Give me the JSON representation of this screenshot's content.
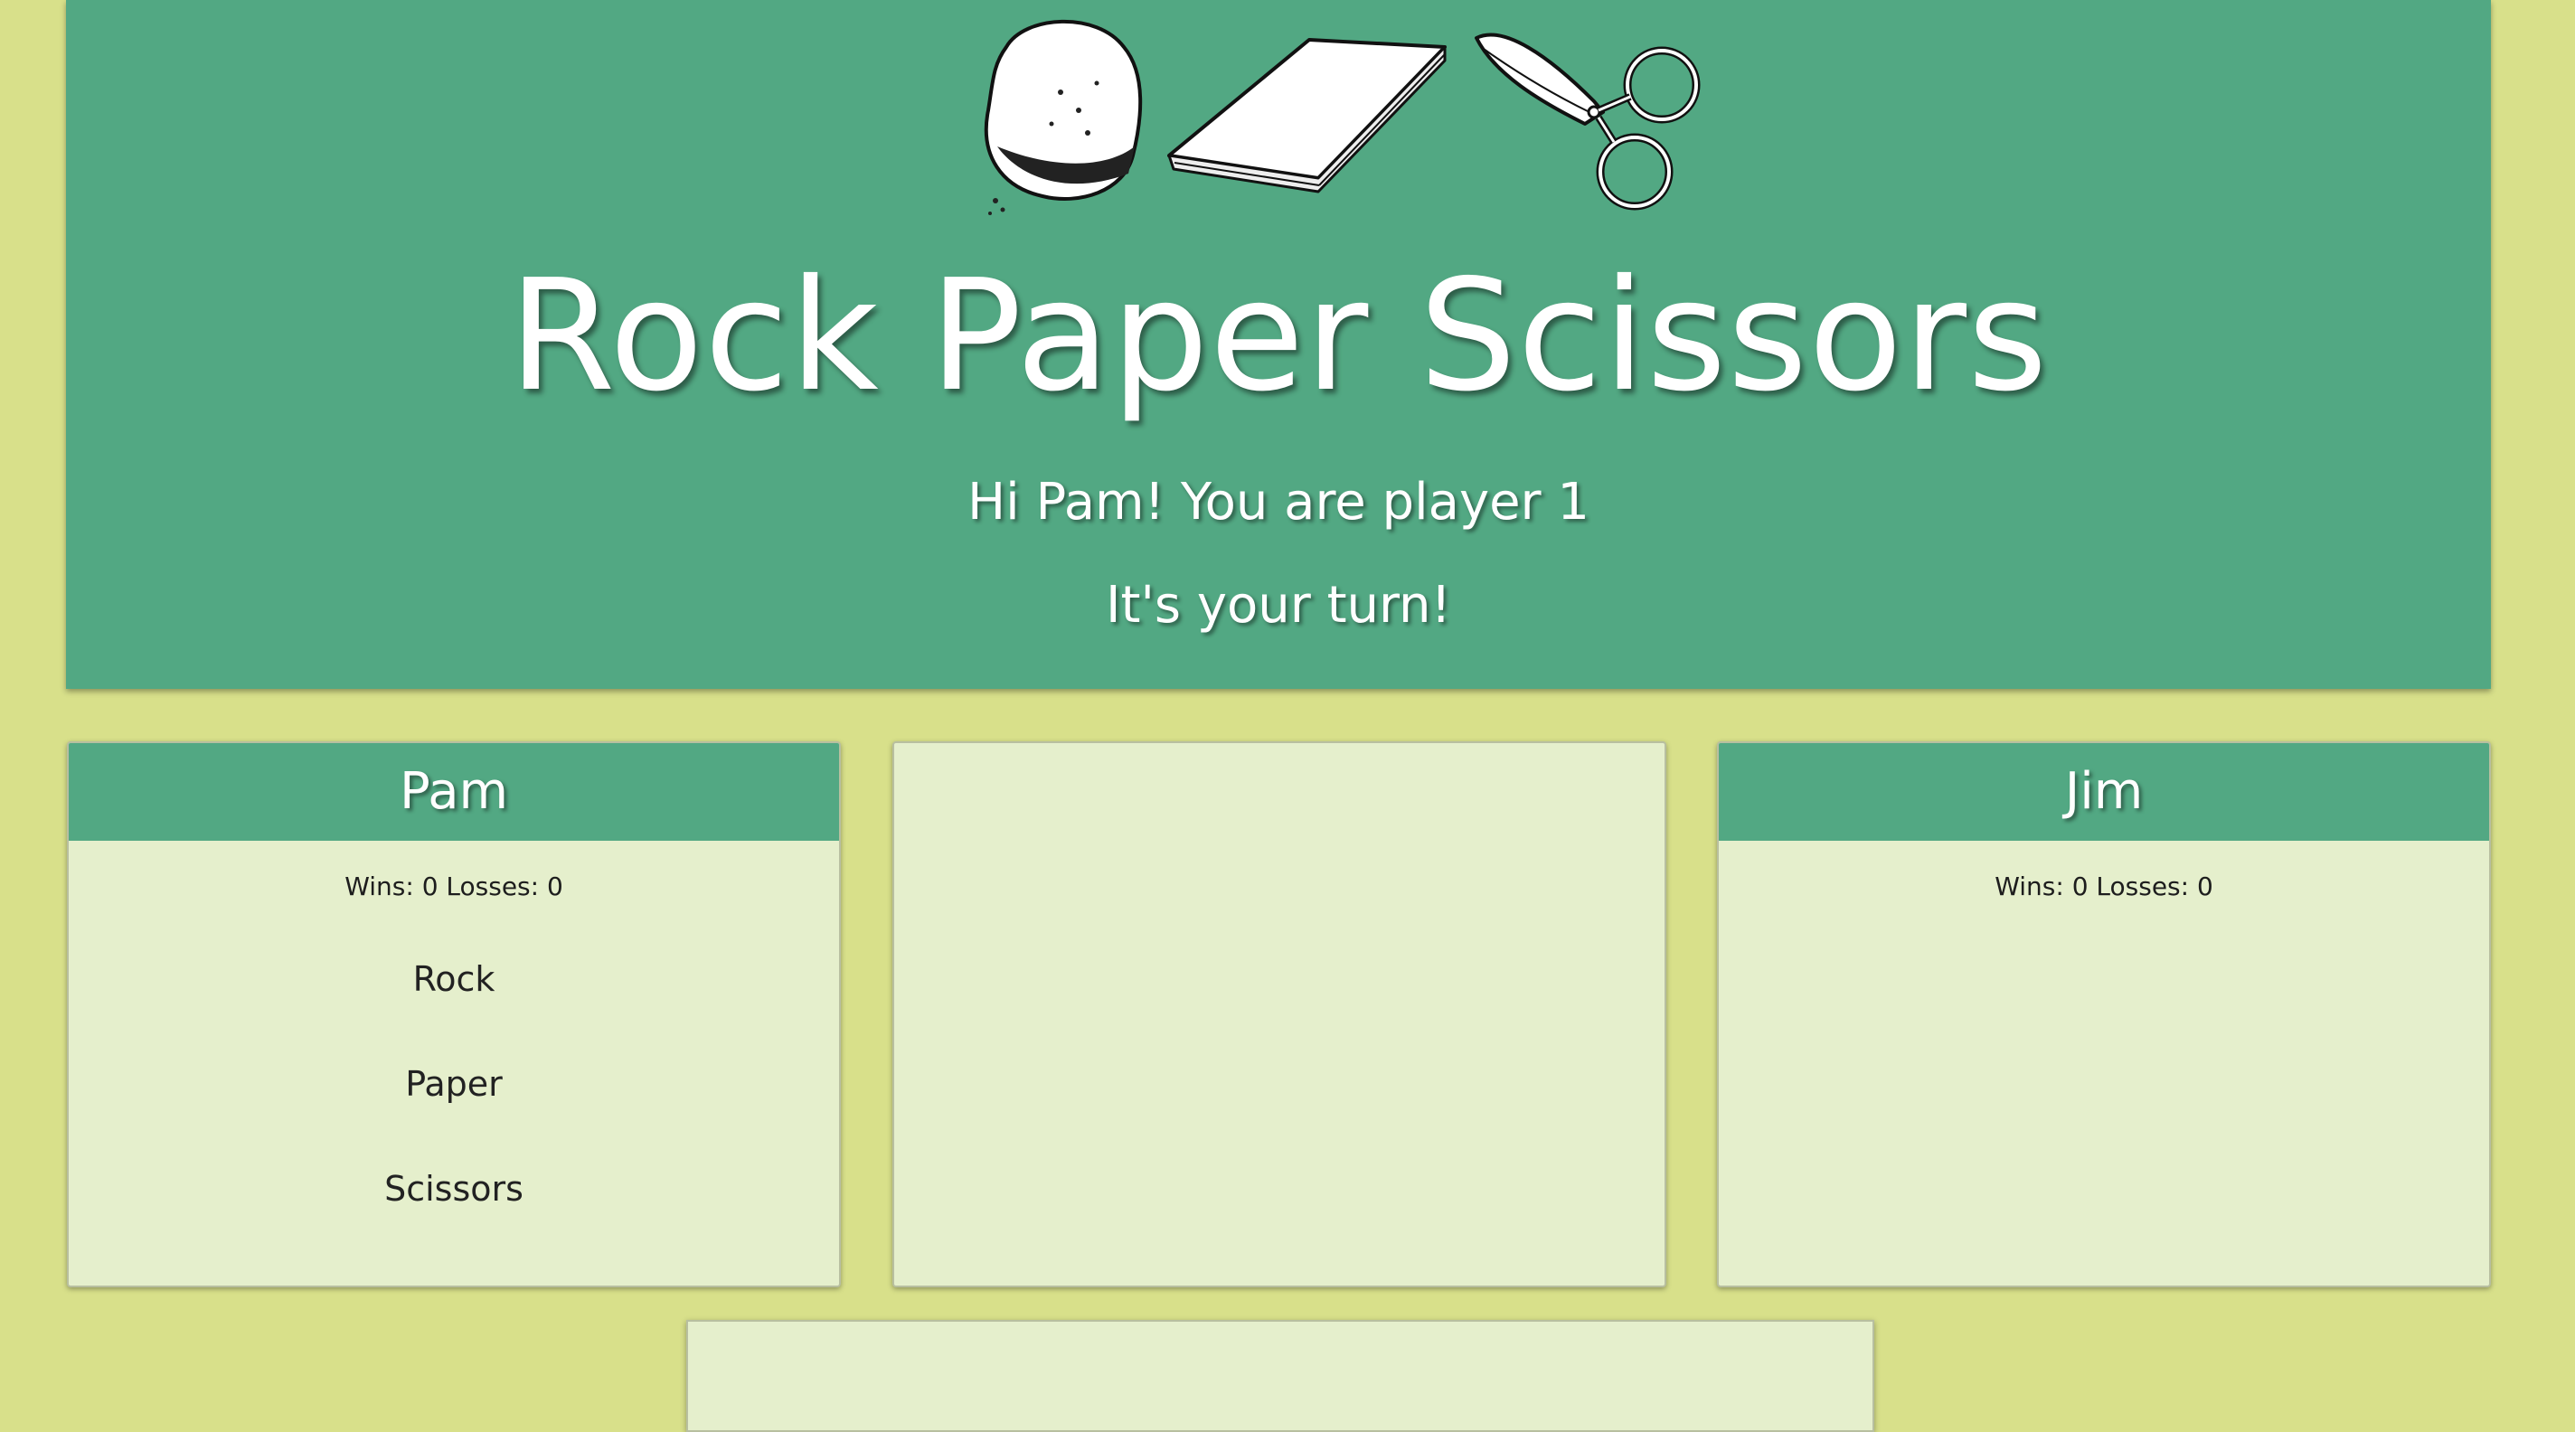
{
  "header": {
    "title": "Rock Paper Scissors",
    "greeting": "Hi Pam! You are player 1",
    "status": "It's your turn!",
    "illustrations": [
      "rock-illustration",
      "paper-illustration",
      "scissors-illustration"
    ]
  },
  "player1": {
    "name": "Pam",
    "stats": "Wins: 0 Losses: 0",
    "choices": [
      "Rock",
      "Paper",
      "Scissors"
    ]
  },
  "player2": {
    "name": "Jim",
    "stats": "Wins: 0 Losses: 0"
  },
  "colors": {
    "background": "#d8e08a",
    "accent": "#52a883",
    "panel": "#e5efcc"
  }
}
